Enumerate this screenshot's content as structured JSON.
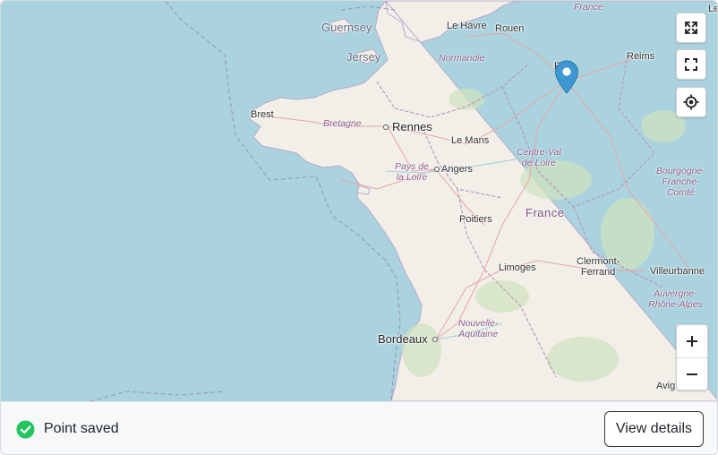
{
  "map": {
    "colors": {
      "sea": "#aad3df",
      "land": "#f2efe9",
      "accent_marker": "#3f97d1",
      "success": "#22c55e"
    },
    "islands": [
      "Guernsey",
      "Jersey"
    ],
    "cities": {
      "le_havre": "Le Havre",
      "rouen": "Rouen",
      "paris": "Paris",
      "reims": "Reims",
      "brest": "Brest",
      "rennes": "Rennes",
      "le_mans": "Le Mans",
      "angers": "Angers",
      "poitiers": "Poitiers",
      "limoges": "Limoges",
      "clermont_ferrand": "Clermont-\nFerrand",
      "villeurbanne": "Villeurbanne",
      "bordeaux": "Bordeaux",
      "avignon_partial": "Avig",
      "lille_partial": "Le"
    },
    "regions": {
      "normandie": "Normandie",
      "bretagne": "Bretagne",
      "pays_de_la_loire": "Pays de\nla Loire",
      "centre_val_de_loire": "Centre-Val\nde Loire",
      "bourgogne": "Bourgogne-\nFranche-\nComté",
      "auvergne": "Auvergne-\nRhône-Alpes",
      "nouvelle_aquitaine": "Nouvelle-\nAquitaine",
      "france_top_partial": "France"
    },
    "country": "France",
    "controls": {
      "expand_icon": "expand-arrows-icon",
      "fullscreen_icon": "fullscreen-icon",
      "locate_icon": "crosshair-icon",
      "zoom_in": "+",
      "zoom_out": "−"
    }
  },
  "footer": {
    "status_icon": "check-circle-icon",
    "status_text": "Point saved",
    "action_label": "View details"
  }
}
